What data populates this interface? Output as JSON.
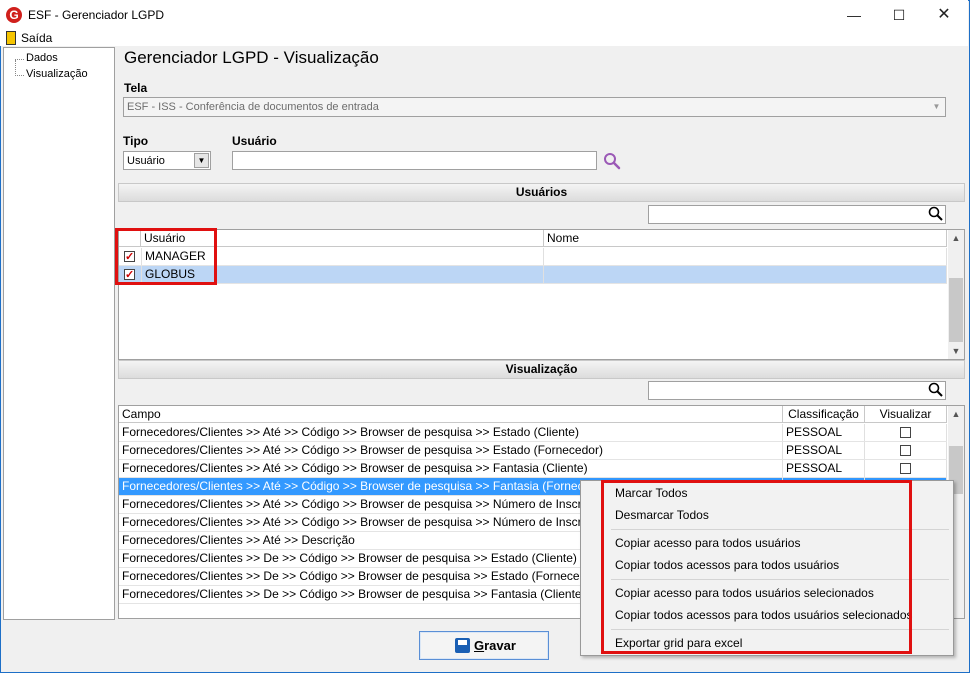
{
  "window": {
    "title": "ESF - Gerenciador LGPD",
    "app_icon_letter": "G"
  },
  "menu": {
    "saida": "Saída"
  },
  "tree": {
    "items": [
      "Dados",
      "Visualização"
    ]
  },
  "page": {
    "title": "Gerenciador LGPD - Visualização"
  },
  "tela": {
    "label": "Tela",
    "value": "ESF - ISS - Conferência de documentos de entrada"
  },
  "tipo": {
    "label": "Tipo",
    "value": "Usuário"
  },
  "usuario": {
    "label": "Usuário",
    "value": ""
  },
  "usuarios_section": {
    "header": "Usuários",
    "columns": [
      "Usuário",
      "Nome"
    ],
    "rows": [
      {
        "usuario": "MANAGER",
        "nome": "",
        "checked": true
      },
      {
        "usuario": "GLOBUS",
        "nome": "",
        "checked": true,
        "selected": true
      }
    ]
  },
  "visualizacao_section": {
    "header": "Visualização",
    "columns": [
      "Campo",
      "Classificação",
      "Visualizar"
    ],
    "rows": [
      {
        "campo": "Fornecedores/Clientes >> Até >> Código >> Browser de pesquisa >> Estado (Cliente)",
        "classificacao": "PESSOAL",
        "visualizar": false
      },
      {
        "campo": "Fornecedores/Clientes >> Até >> Código >> Browser de pesquisa >> Estado (Fornecedor)",
        "classificacao": "PESSOAL",
        "visualizar": false
      },
      {
        "campo": "Fornecedores/Clientes >> Até >> Código >> Browser de pesquisa >> Fantasia (Cliente)",
        "classificacao": "PESSOAL",
        "visualizar": false
      },
      {
        "campo": "Fornecedores/Clientes >> Até >> Código >> Browser de pesquisa >> Fantasia (Fornecedor)",
        "classificacao": "",
        "visualizar": false,
        "selected": true
      },
      {
        "campo": "Fornecedores/Clientes >> Até >> Código >> Browser de pesquisa >> Número de Inscrição (Cliente",
        "classificacao": "",
        "visualizar": false
      },
      {
        "campo": "Fornecedores/Clientes >> Até >> Código >> Browser de pesquisa >> Número de Inscrição (Forne",
        "classificacao": "",
        "visualizar": false
      },
      {
        "campo": "Fornecedores/Clientes >> Até >> Descrição",
        "classificacao": "",
        "visualizar": false
      },
      {
        "campo": "Fornecedores/Clientes >> De >> Código >> Browser de pesquisa >> Estado (Cliente)",
        "classificacao": "",
        "visualizar": false
      },
      {
        "campo": "Fornecedores/Clientes >> De >> Código >> Browser de pesquisa >> Estado (Fornecedor)",
        "classificacao": "",
        "visualizar": false
      },
      {
        "campo": "Fornecedores/Clientes >> De >> Código >> Browser de pesquisa >> Fantasia (Cliente)",
        "classificacao": "",
        "visualizar": false
      }
    ]
  },
  "context_menu": {
    "items": [
      "Marcar Todos",
      "Desmarcar Todos",
      "Copiar acesso para todos usuários",
      "Copiar todos acessos para todos usuários",
      "Copiar acesso para todos usuários selecionados",
      "Copiar todos acessos para todos usuários selecionados",
      "Exportar grid para excel"
    ]
  },
  "buttons": {
    "gravar": "Gravar"
  },
  "colors": {
    "selection": "#3399ff",
    "selection_light": "#bcd6f5",
    "highlight_box": "#e01010",
    "search_icon": "#9b59b6"
  },
  "icons": {
    "search": "search-icon",
    "save": "save-icon",
    "exit": "exit-door-icon"
  }
}
